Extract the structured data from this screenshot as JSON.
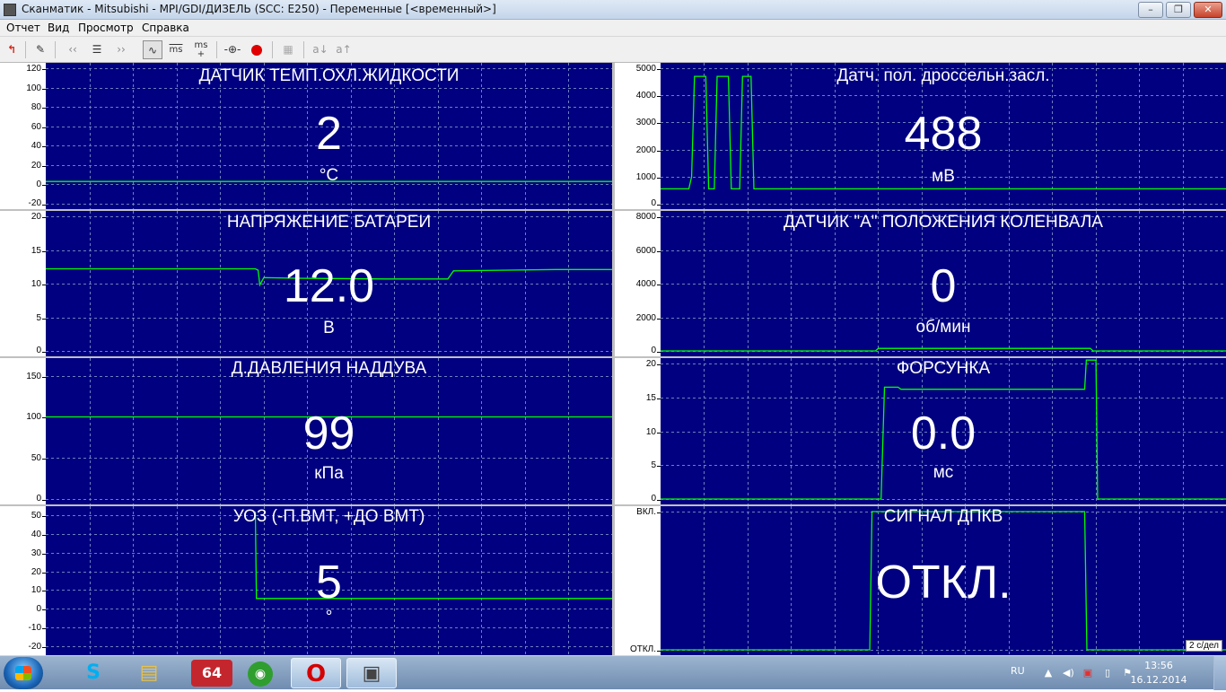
{
  "window": {
    "title": "Сканматик - Mitsubishi - MPI/GDI/ДИЗЕЛЬ (SCC: E250) - Переменные [<временный>]"
  },
  "menu": {
    "items": [
      "Отчет",
      "Вид",
      "Просмотр",
      "Справка"
    ]
  },
  "toolbar": {
    "ms_label": "ms",
    "ms_plus_label": "ms"
  },
  "colors": {
    "plot_background": "#000080",
    "trace": "#00ff00",
    "grid": "#6e7fbf",
    "text": "#ffffff"
  },
  "panels": [
    {
      "id": "coolant",
      "title": "ДАТЧИК ТЕМП.ОХЛ.ЖИДКОСТИ",
      "value": "2",
      "unit": "°C",
      "ticks": [
        "120",
        "100",
        "80",
        "60",
        "40",
        "20",
        "0",
        "-20"
      ],
      "ymin": -20,
      "ymax": 120,
      "trace": [
        [
          0,
          3
        ],
        [
          100,
          3
        ]
      ]
    },
    {
      "id": "tps",
      "title": "Датч. пол. дроссельн.засл.",
      "value": "488",
      "unit": "мВ",
      "ticks": [
        "5000",
        "4000",
        "3000",
        "2000",
        "1000",
        "0"
      ],
      "ymin": 0,
      "ymax": 5000,
      "trace": [
        [
          0,
          550
        ],
        [
          5,
          550
        ],
        [
          5.5,
          1000
        ],
        [
          6,
          4700
        ],
        [
          8,
          4700
        ],
        [
          8.5,
          550
        ],
        [
          9.5,
          550
        ],
        [
          10,
          4700
        ],
        [
          12,
          4700
        ],
        [
          12.5,
          550
        ],
        [
          14,
          550
        ],
        [
          14.5,
          4700
        ],
        [
          16,
          4700
        ],
        [
          16.5,
          550
        ],
        [
          100,
          550
        ]
      ]
    },
    {
      "id": "battery",
      "title": "НАПРЯЖЕНИЕ БАТАРЕИ",
      "value": "12.0",
      "unit": "В",
      "ticks": [
        "20",
        "15",
        "10",
        "5",
        "0"
      ],
      "ymin": 0,
      "ymax": 20,
      "trace": [
        [
          0,
          12.2
        ],
        [
          37,
          12.2
        ],
        [
          37.5,
          12.0
        ],
        [
          37.8,
          9.8
        ],
        [
          38.5,
          10.9
        ],
        [
          44,
          10.8
        ],
        [
          60,
          10.7
        ],
        [
          71,
          10.7
        ],
        [
          72,
          11.9
        ],
        [
          90,
          12.1
        ],
        [
          100,
          12.1
        ]
      ]
    },
    {
      "id": "rpm",
      "title": "ДАТЧИК \"А\" ПОЛОЖЕНИЯ КОЛЕНВАЛА",
      "value": "0",
      "unit": "об/мин",
      "ticks": [
        "8000",
        "6000",
        "4000",
        "2000",
        "0"
      ],
      "ymin": 0,
      "ymax": 8000,
      "trace": [
        [
          0,
          0
        ],
        [
          38,
          0
        ],
        [
          38.5,
          150
        ],
        [
          76,
          150
        ],
        [
          76.5,
          0
        ],
        [
          100,
          0
        ]
      ]
    },
    {
      "id": "boost",
      "title": "Д.ДАВЛЕНИЯ НАДДУВА",
      "value": "99",
      "unit": "кПа",
      "ticks": [
        "150",
        "100",
        "50",
        "0"
      ],
      "ymin": 0,
      "ymax": 165,
      "trace": [
        [
          0,
          100
        ],
        [
          100,
          100
        ]
      ]
    },
    {
      "id": "injector",
      "title": "ФОРСУНКА",
      "value": "0.0",
      "unit": "мс",
      "ticks": [
        "20",
        "15",
        "10",
        "5",
        "0"
      ],
      "ymin": 0,
      "ymax": 20,
      "trace": [
        [
          0,
          0
        ],
        [
          39,
          0
        ],
        [
          39.6,
          16.5
        ],
        [
          42,
          16.5
        ],
        [
          42.5,
          16.2
        ],
        [
          75,
          16.2
        ],
        [
          75.3,
          20.5
        ],
        [
          77,
          20.5
        ],
        [
          77.3,
          0
        ],
        [
          100,
          0
        ]
      ]
    },
    {
      "id": "timing",
      "title": "УОЗ (-П.ВМТ, +ДО ВМТ)",
      "value": "5",
      "unit": "°",
      "ticks": [
        "50",
        "40",
        "30",
        "20",
        "10",
        "0",
        "-10",
        "-20"
      ],
      "ymin": -22,
      "ymax": 52,
      "trace": [
        [
          37,
          52
        ],
        [
          37.2,
          5.5
        ],
        [
          100,
          5.5
        ]
      ]
    },
    {
      "id": "ckp_signal",
      "title": "СИГНАЛ ДПКВ",
      "value": "ОТКЛ.",
      "unit": "",
      "ticks": [
        "ВКЛ.",
        "ОТКЛ."
      ],
      "ymin": 0,
      "ymax": 1,
      "trace": [
        [
          0,
          0
        ],
        [
          37,
          0
        ],
        [
          37.4,
          1
        ],
        [
          75,
          1
        ],
        [
          75.4,
          0
        ],
        [
          100,
          0
        ]
      ]
    }
  ],
  "timescale": "2 с/дел",
  "taskbar": {
    "tasks": [
      {
        "name": "skype",
        "label": "S"
      },
      {
        "name": "explorer",
        "label": "▤"
      },
      {
        "name": "aida64",
        "label": "64"
      },
      {
        "name": "network-tool",
        "label": "◉"
      },
      {
        "name": "opera",
        "label": "O"
      },
      {
        "name": "scanmatic",
        "label": "▣"
      }
    ],
    "lang": "RU",
    "time": "13:56",
    "date": "16.12.2014"
  }
}
